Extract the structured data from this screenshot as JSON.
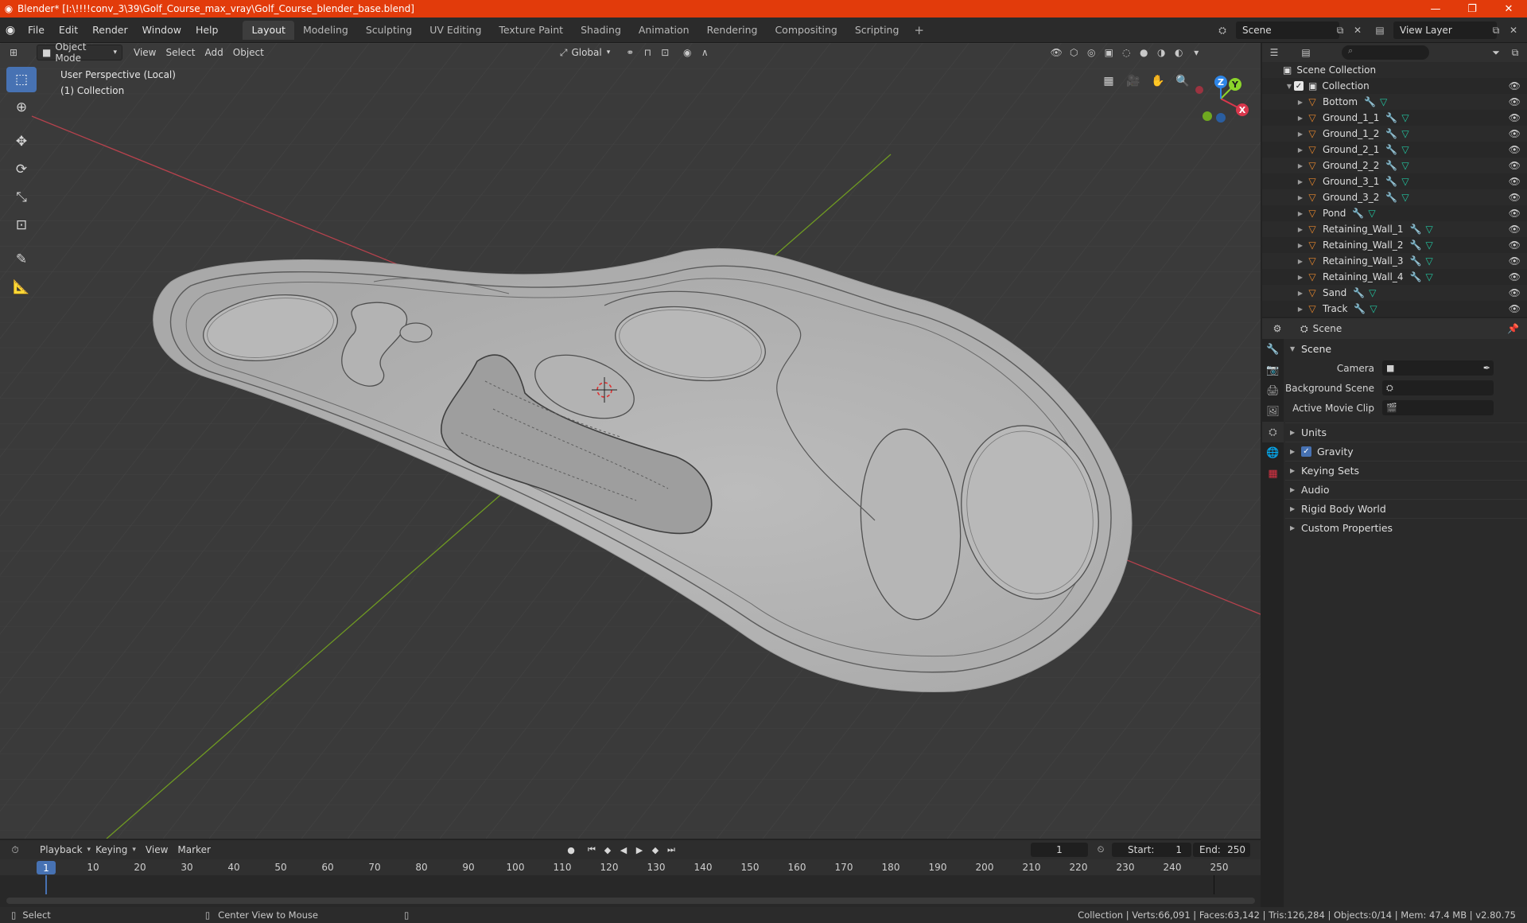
{
  "window": {
    "title": "Blender* [I:\\!!!!conv_3\\39\\Golf_Course_max_vray\\Golf_Course_blender_base.blend]",
    "minimize": "—",
    "maximize": "❐",
    "close": "✕"
  },
  "menu": [
    "File",
    "Edit",
    "Render",
    "Window",
    "Help"
  ],
  "workspaces": [
    "Layout",
    "Modeling",
    "Sculpting",
    "UV Editing",
    "Texture Paint",
    "Shading",
    "Animation",
    "Rendering",
    "Compositing",
    "Scripting"
  ],
  "workspace_add": "+",
  "topbar": {
    "scene": "Scene",
    "view_layer": "View Layer"
  },
  "viewport": {
    "mode": "Object Mode",
    "menus": [
      "View",
      "Select",
      "Add",
      "Object"
    ],
    "transform_orientation": "Global",
    "info_line1": "User Perspective (Local)",
    "info_line2": "(1) Collection",
    "axis_x": "X",
    "axis_y": "Y",
    "axis_z": "Z"
  },
  "outliner": {
    "root": "Scene Collection",
    "collection": "Collection",
    "objects": [
      "Bottom",
      "Ground_1_1",
      "Ground_1_2",
      "Ground_2_1",
      "Ground_2_2",
      "Ground_3_1",
      "Ground_3_2",
      "Pond",
      "Retaining_Wall_1",
      "Retaining_Wall_2",
      "Retaining_Wall_3",
      "Retaining_Wall_4",
      "Sand",
      "Track"
    ]
  },
  "properties": {
    "context": "Scene",
    "panel": "Scene",
    "camera_label": "Camera",
    "background_scene_label": "Background Scene",
    "active_movie_clip_label": "Active Movie Clip",
    "subpanels": [
      "Units",
      "Gravity",
      "Keying Sets",
      "Audio",
      "Rigid Body World",
      "Custom Properties"
    ]
  },
  "timeline": {
    "menus": [
      "Playback",
      "Keying",
      "View",
      "Marker"
    ],
    "current_frame": "1",
    "start_label": "Start:",
    "start_value": "1",
    "end_label": "End:",
    "end_value": "250",
    "ruler_marks": [
      "10",
      "20",
      "30",
      "40",
      "50",
      "60",
      "70",
      "80",
      "90",
      "100",
      "110",
      "120",
      "130",
      "140",
      "150",
      "160",
      "170",
      "180",
      "190",
      "200",
      "210",
      "220",
      "230",
      "240",
      "250"
    ]
  },
  "status": {
    "left": "Select",
    "middle": "Center View to Mouse",
    "right": "Collection | Verts:66,091 | Faces:63,142 | Tris:126,284 | Objects:0/14 | Mem: 47.4 MB | v2.80.75"
  },
  "colors": {
    "title_bar": "#e23b0b",
    "accent": "#4772b3",
    "object_icon": "#e8872c",
    "mesh_icon": "#22c5a0",
    "modifier_icon": "#4d98e8",
    "axis_x": "#d9374c",
    "axis_y": "#8bd42b",
    "axis_z": "#2e86e8"
  }
}
